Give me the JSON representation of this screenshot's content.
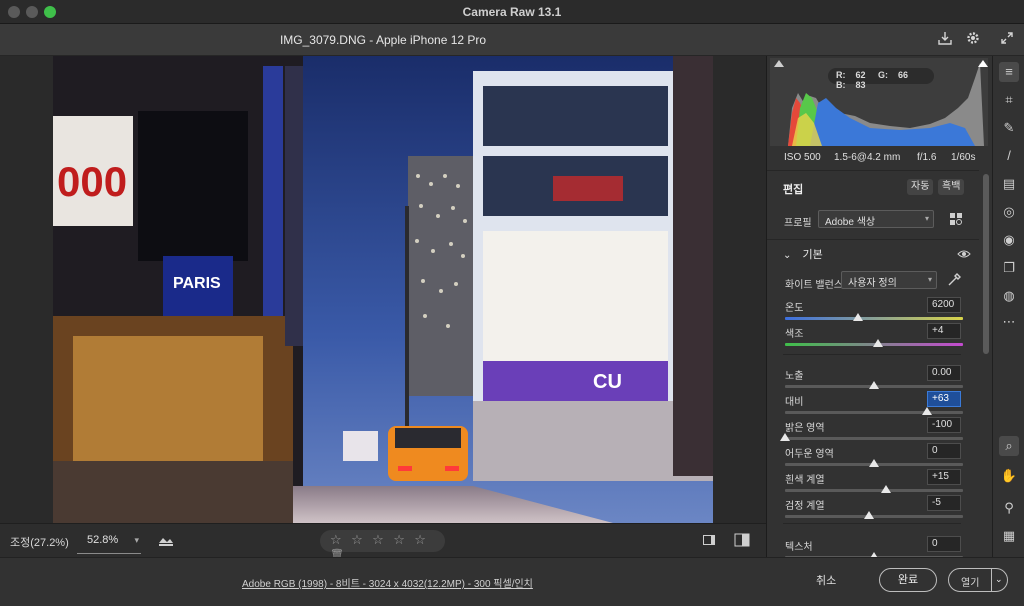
{
  "window": {
    "title": "Camera Raw 13.1"
  },
  "header": {
    "file_title": "IMG_3079.DNG  -  Apple iPhone 12 Pro",
    "icons": [
      "save-icon",
      "gear-icon",
      "fullscreen-icon"
    ]
  },
  "viewbar": {
    "fit_label": "조정(27.2%)",
    "zoom_value": "52.8%",
    "rating_stars": 0
  },
  "footer": {
    "info_link": "Adobe RGB (1998) - 8비트 - 3024 x 4032(12.2MP) - 300 픽셀/인치",
    "cancel": "취소",
    "done": "완료",
    "open": "열기"
  },
  "histogram": {
    "r": "R:",
    "r_val": "62",
    "g": "G:",
    "g_val": "66",
    "b": "B:",
    "b_val": "83"
  },
  "exif": {
    "iso": "ISO 500",
    "lens": "1.5-6@4.2 mm",
    "aperture": "f/1.6",
    "shutter": "1/60s"
  },
  "edit": {
    "title": "편집",
    "auto": "자동",
    "bw": "흑백",
    "profile_label": "프로필",
    "profile_value": "Adobe 색상",
    "basic_section": "기본",
    "wb_label": "화이트 밸런스",
    "wb_value": "사용자 정의"
  },
  "sliders": [
    {
      "label": "온도",
      "value": "6200",
      "pos": 0.41
    },
    {
      "label": "색조",
      "value": "+4",
      "pos": 0.52
    },
    {
      "label": "노출",
      "value": "0.00",
      "pos": 0.5
    },
    {
      "label": "대비",
      "value": "+63",
      "pos": 0.8
    },
    {
      "label": "밝은 영역",
      "value": "-100",
      "pos": 0.0
    },
    {
      "label": "어두운 영역",
      "value": "0",
      "pos": 0.5
    },
    {
      "label": "흰색 계열",
      "value": "+15",
      "pos": 0.57
    },
    {
      "label": "검정 계열",
      "value": "-5",
      "pos": 0.47
    },
    {
      "label": "텍스처",
      "value": "0",
      "pos": 0.5
    }
  ],
  "tools": [
    "edit-sliders-icon",
    "crop-icon",
    "healing-icon",
    "brush-icon",
    "gradient-icon",
    "radial-icon",
    "redeye-icon",
    "snapshots-icon",
    "presets-icon",
    "more-icon",
    "zoom-icon",
    "hand-icon",
    "color-sampler-icon",
    "grid-icon"
  ],
  "colors": {
    "accent": "#3b7bd9",
    "panel": "#323232"
  }
}
